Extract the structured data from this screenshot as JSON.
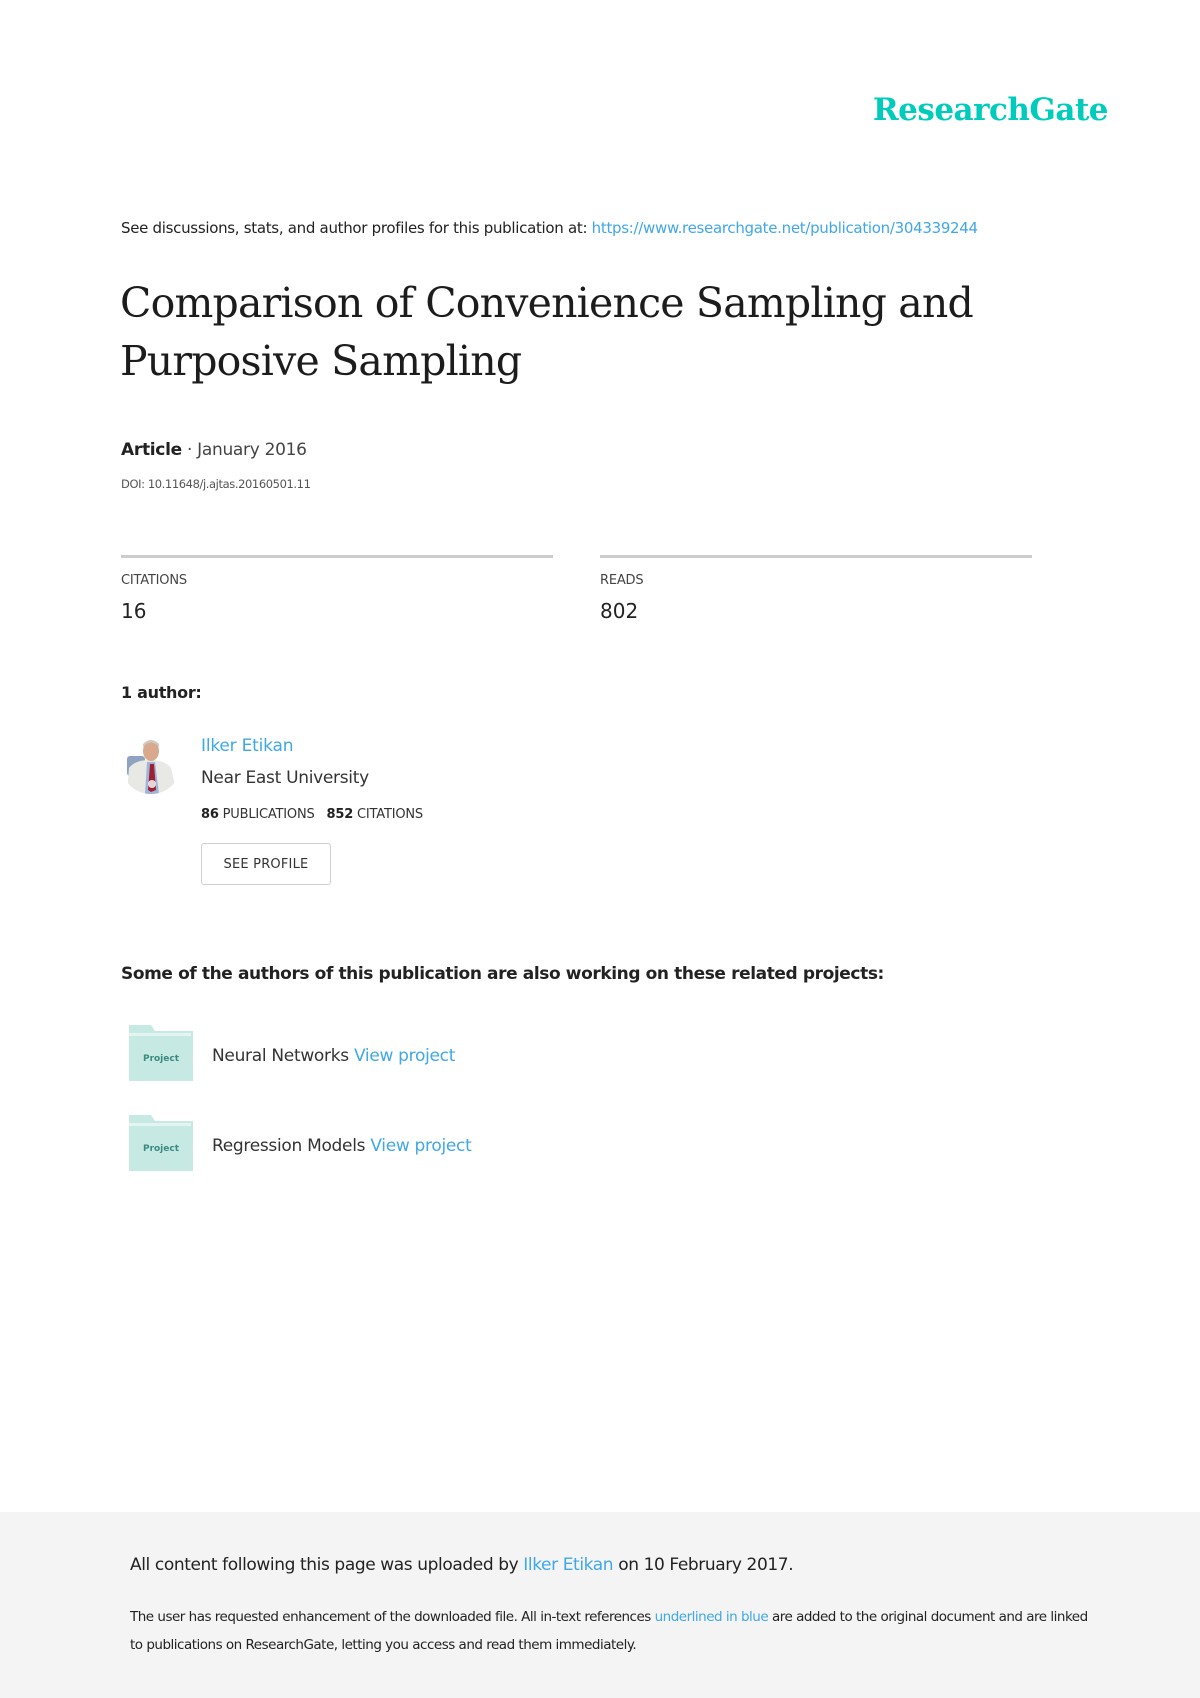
{
  "brand": {
    "logo_text": "ResearchGate",
    "accent_color": "#00ccbb",
    "link_color": "#40a8e6"
  },
  "header": {
    "discussion_prefix": "See discussions, stats, and author profiles for this publication at: ",
    "publication_url": "https://www.researchgate.net/publication/304339244"
  },
  "publication": {
    "title": "Comparison of Convenience Sampling and Purposive Sampling",
    "type": "Article",
    "separator": " · ",
    "date": "January 2016",
    "doi": "DOI: 10.11648/j.ajtas.20160501.11"
  },
  "stats": [
    {
      "label": "CITATIONS",
      "value": "16"
    },
    {
      "label": "READS",
      "value": "802"
    }
  ],
  "authors": {
    "heading": "1 author:",
    "list": [
      {
        "name": "Ilker Etikan",
        "institution": "Near East University",
        "publications_count": "86",
        "publications_label": "PUBLICATIONS",
        "citations_count": "852",
        "citations_label": "CITATIONS",
        "see_profile_label": "SEE PROFILE"
      }
    ]
  },
  "related_projects": {
    "heading": "Some of the authors of this publication are also working on these related projects:",
    "icon_label": "Project",
    "items": [
      {
        "name": "Neural Networks",
        "link_label": "View project"
      },
      {
        "name": "Regression Models",
        "link_label": "View project"
      }
    ]
  },
  "footer": {
    "upload_prefix": "All content following this page was uploaded by ",
    "uploader": "Ilker Etikan",
    "upload_suffix": " on 10 February 2017.",
    "note_part1": "The user has requested enhancement of the downloaded file. All in-text references ",
    "note_link": "underlined in blue",
    "note_part2": " are added to the original document and are linked to publications on ResearchGate, letting you access and read them immediately."
  }
}
